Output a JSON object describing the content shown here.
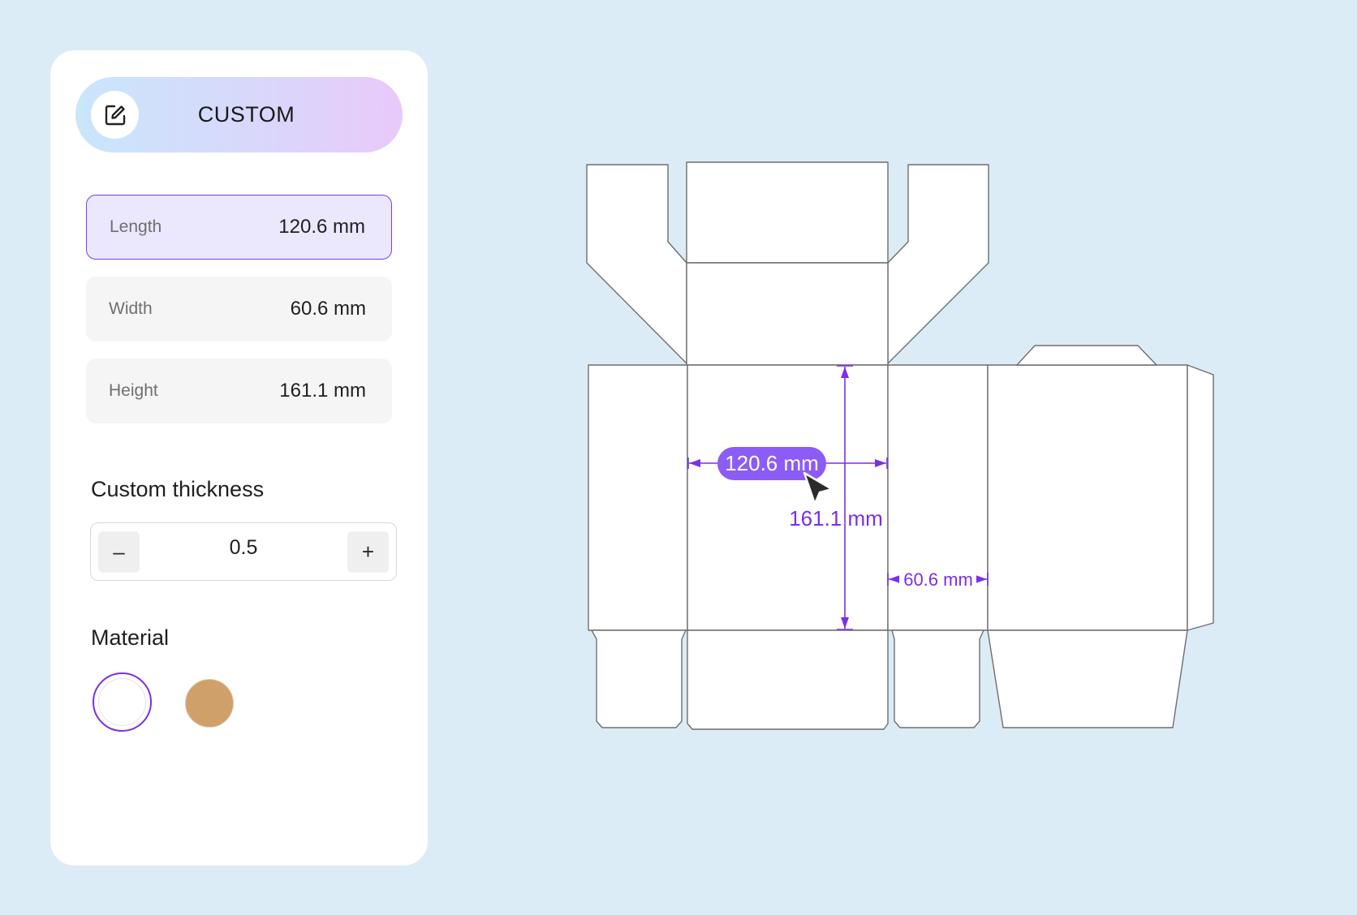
{
  "panel": {
    "mode_button": {
      "label": "CUSTOM",
      "icon": "edit-square-icon"
    },
    "dimensions": [
      {
        "label": "Length",
        "value": "120.6 mm",
        "active": true
      },
      {
        "label": "Width",
        "value": "60.6 mm",
        "active": false
      },
      {
        "label": "Height",
        "value": "161.1 mm",
        "active": false
      }
    ],
    "thickness": {
      "title": "Custom thickness",
      "value": "0.5",
      "minus_label": "–",
      "plus_label": "+"
    },
    "material": {
      "title": "Material",
      "options": [
        {
          "name": "white",
          "color": "#ffffff",
          "selected": true
        },
        {
          "name": "kraft",
          "color": "#cfa06a",
          "selected": false
        }
      ]
    }
  },
  "dieline": {
    "length_label": "120.6 mm",
    "height_label": "161.1 mm",
    "width_label": "60.6 mm",
    "line_color": "#6e6e6e",
    "dimension_color": "#7b2ee8",
    "badge_color": "#8b5cf6"
  }
}
